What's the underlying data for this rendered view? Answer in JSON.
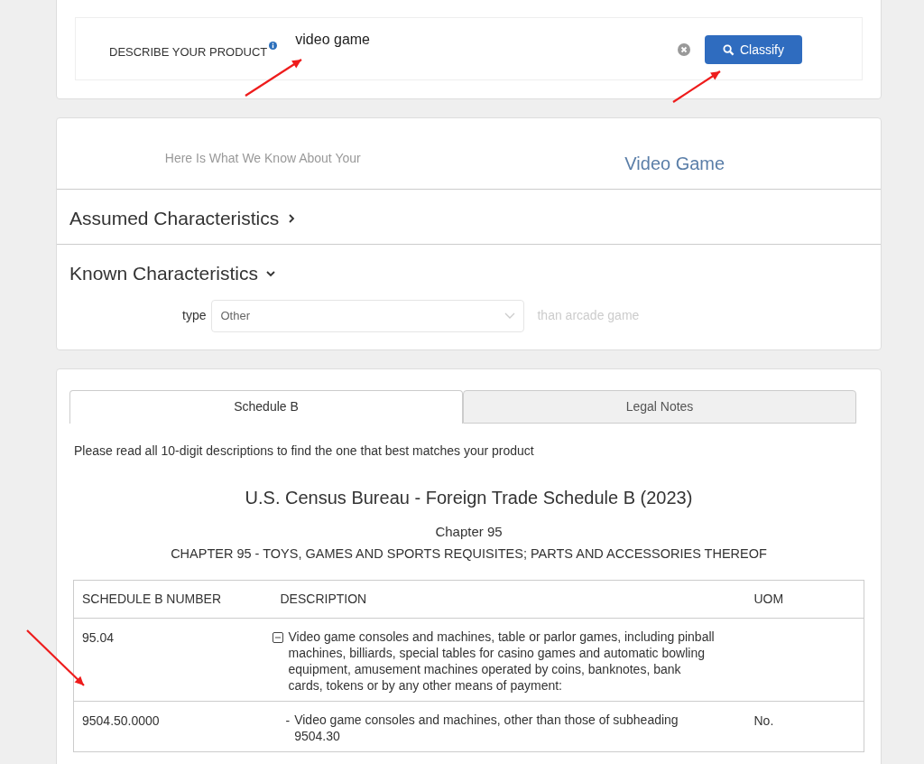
{
  "search": {
    "label": "DESCRIBE YOUR PRODUCT",
    "value": "video game",
    "button": "Classify"
  },
  "knowledge": {
    "intro": "Here Is What We Know About Your",
    "product": "Video Game"
  },
  "sections": [
    {
      "title": "Assumed Characteristics",
      "expanded": false
    },
    {
      "title": "Known Characteristics",
      "expanded": true
    }
  ],
  "known_fields": [
    {
      "label": "type",
      "value": "Other",
      "suffix": "than arcade game"
    }
  ],
  "tabs": [
    {
      "label": "Schedule B",
      "selected": true
    },
    {
      "label": "Legal Notes",
      "selected": false
    }
  ],
  "instruction": "Please read all 10-digit descriptions to find the one that best matches your product",
  "schedule_title": "U.S. Census Bureau - Foreign Trade Schedule B (2023)",
  "chapter": "Chapter 95",
  "chapter_title": "CHAPTER 95 - TOYS, GAMES AND SPORTS REQUISITES; PARTS AND ACCESSORIES THEREOF",
  "table": {
    "columns": [
      "SCHEDULE B NUMBER",
      "DESCRIPTION",
      "UOM"
    ],
    "rows": [
      {
        "kind": "heading",
        "expanded": true,
        "number": "95.04",
        "description": "Video game consoles and machines, table or parlor games, including pinball machines, billiards, special tables for casino games and automatic bowling equipment, amusement machines operated by coins, banknotes, bank cards, tokens or by any other means of payment:"
      },
      {
        "kind": "item",
        "number": "9504.50.0000",
        "dash": "-",
        "description": "Video game consoles and machines, other than those of subheading 9504.30",
        "uom": "No."
      }
    ]
  }
}
